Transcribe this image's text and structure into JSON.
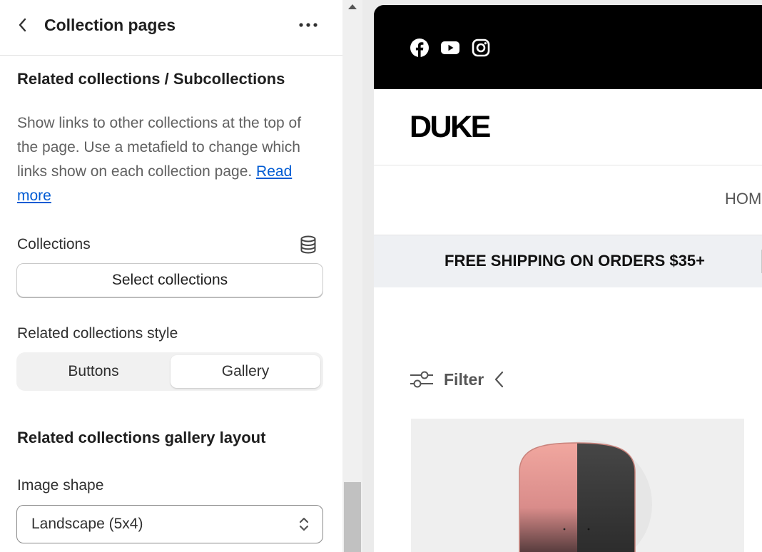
{
  "panel": {
    "title": "Collection pages",
    "section_title": "Related collections / Subcollections",
    "description": "Show links to other collections at the top of the page. Use a metafield to change which links show on each collection page.",
    "read_more": "Read more",
    "collections_label": "Collections",
    "select_collections_label": "Select collections",
    "style_label": "Related collections style",
    "style_options": [
      "Buttons",
      "Gallery"
    ],
    "style_selected": "Gallery",
    "gallery_layout_title": "Related collections gallery layout",
    "image_shape_label": "Image shape",
    "image_shape_value": "Landscape (5x4)"
  },
  "preview": {
    "social_icons": [
      "facebook-icon",
      "youtube-icon",
      "instagram-icon"
    ],
    "logo": "DUKE",
    "nav_first": "HOM",
    "shipping_banner": "FREE SHIPPING ON ORDERS $35+",
    "filter_label": "Filter"
  },
  "colors": {
    "link": "#005bd3",
    "announce_bg": "#000000",
    "ship_bg": "#eef0f3",
    "product_pink": "#e8a0a0",
    "product_dark": "#333333"
  }
}
